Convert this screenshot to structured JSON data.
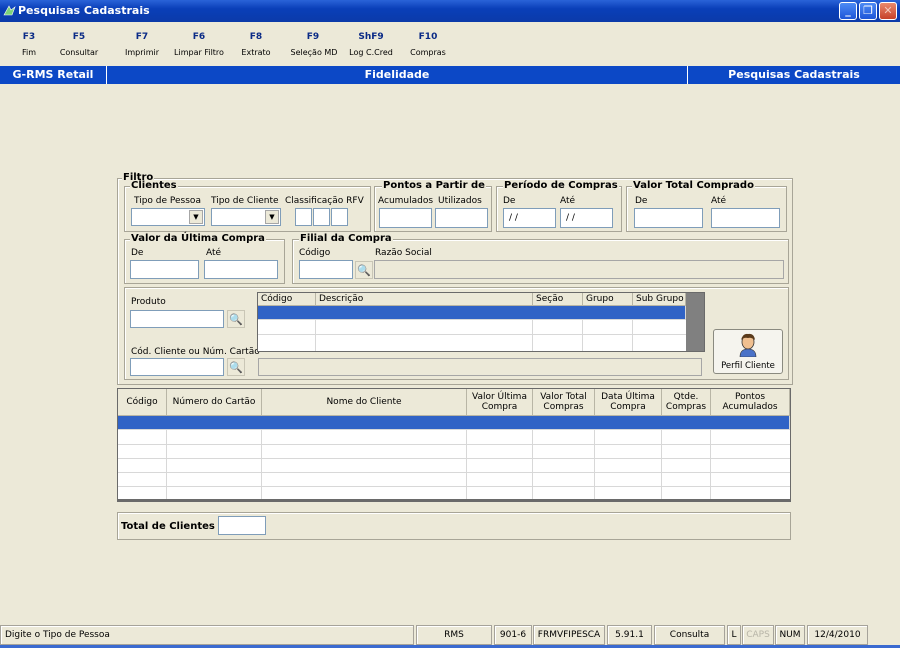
{
  "window": {
    "title": "Pesquisas Cadastrais"
  },
  "toolbar": [
    {
      "key": "F3",
      "label": "Fim"
    },
    {
      "key": "F5",
      "label": "Consultar"
    },
    {
      "key": "F7",
      "label": "Imprimir"
    },
    {
      "key": "F6",
      "label": "Limpar Filtro"
    },
    {
      "key": "F8",
      "label": "Extrato"
    },
    {
      "key": "F9",
      "label": "Seleção MD"
    },
    {
      "key": "ShF9",
      "label": "Log C.Cred"
    },
    {
      "key": "F10",
      "label": "Compras"
    }
  ],
  "header": {
    "left": "G-RMS Retail",
    "center": "Fidelidade",
    "right": "Pesquisas Cadastrais"
  },
  "filtro": {
    "title": "Filtro",
    "clientes": {
      "title": "Clientes",
      "tipo_pessoa": "Tipo de Pessoa",
      "tipo_cliente": "Tipo de Cliente",
      "classificacao": "Classificação RFV"
    },
    "pontos": {
      "title": "Pontos a Partir de",
      "acumulados": "Acumulados",
      "utilizados": "Utilizados"
    },
    "periodo": {
      "title": "Período de Compras",
      "de": "De",
      "ate": "Até",
      "de_value": "/ /",
      "ate_value": "/ /"
    },
    "valor_total": {
      "title": "Valor Total Comprado",
      "de": "De",
      "ate": "Até"
    },
    "valor_ultima": {
      "title": "Valor da Última Compra",
      "de": "De",
      "ate": "Até"
    },
    "filial": {
      "title": "Filial da Compra",
      "codigo": "Código",
      "razao": "Razão Social"
    },
    "produto": "Produto",
    "cod_cliente": "Cód. Cliente ou Núm. Cartão",
    "produto_grid": {
      "columns": [
        "Código",
        "Descrição",
        "Seção",
        "Grupo",
        "Sub Grupo"
      ]
    },
    "perfil_button": "Perfil Cliente"
  },
  "results": {
    "columns": [
      "Código",
      "Número do Cartão",
      "Nome do Cliente",
      "Valor Última Compra",
      "Valor Total Compras",
      "Data Última Compra",
      "Qtde. Compras",
      "Pontos Acumulados"
    ]
  },
  "total": {
    "label": "Total de Clientes :"
  },
  "statusbar": {
    "message": "Digite o Tipo de Pessoa",
    "system": "RMS",
    "code": "901-6",
    "form": "FRMVFIPESCA",
    "version": "5.91.1",
    "mode": "Consulta",
    "l": "L",
    "caps": "CAPS",
    "num": "NUM",
    "date": "12/4/2010"
  }
}
